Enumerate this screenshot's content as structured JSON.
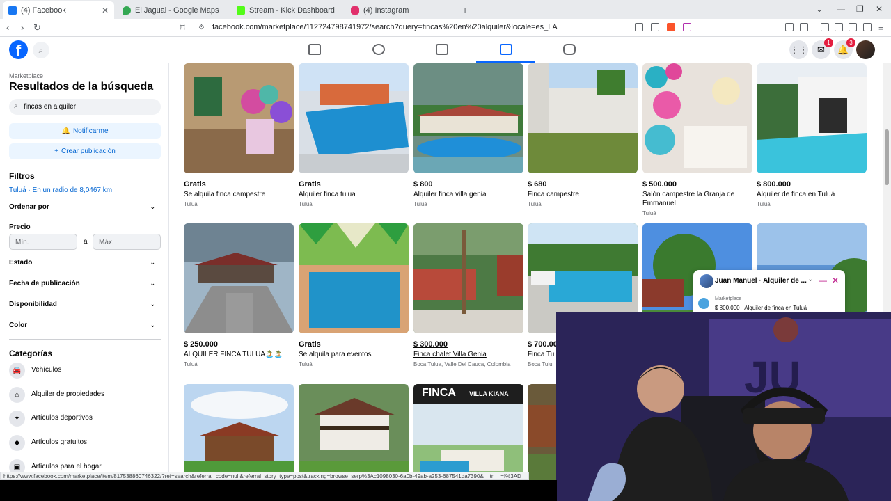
{
  "browser": {
    "tabs": [
      {
        "label": "(4) Facebook",
        "active": true,
        "color": "#1877f2"
      },
      {
        "label": "El Jagual - Google Maps",
        "active": false,
        "color": "#34a853"
      },
      {
        "label": "Stream - Kick Dashboard",
        "active": false,
        "color": "#53fc18"
      },
      {
        "label": "(4) Instagram",
        "active": false,
        "color": "#e1306c"
      }
    ],
    "new_tab": "+",
    "url": "facebook.com/marketplace/112724798741972/search?query=fincas%20en%20alquiler&locale=es_LA",
    "status_url": "https://www.facebook.com/marketplace/item/817538860746322/?ref=search&referral_code=null&referral_story_type=post&tracking=browse_serp%3Ac1098030-6a0b-49ab-a253-687541da7390&__tn__=!%3AD"
  },
  "header": {
    "logo": "f",
    "messenger_badge": "1",
    "notifications_badge": "3"
  },
  "sidebar": {
    "breadcrumb": "Marketplace",
    "title": "Resultados de la búsqueda",
    "search_value": "fincas en alquiler",
    "notify_label": "Notificarme",
    "create_label": "Crear publicación",
    "filters_heading": "Filtros",
    "location": "Tuluá · En un radio de 8,0467 km",
    "sort_label": "Ordenar por",
    "price_label": "Precio",
    "price_min_placeholder": "Mín.",
    "price_to": "a",
    "price_max_placeholder": "Máx.",
    "state_label": "Estado",
    "date_label": "Fecha de publicación",
    "availability_label": "Disponibilidad",
    "color_label": "Color",
    "categories_heading": "Categorías",
    "categories": [
      {
        "label": "Vehículos",
        "icon": "car-icon"
      },
      {
        "label": "Alquiler de propiedades",
        "icon": "house-icon"
      },
      {
        "label": "Artículos deportivos",
        "icon": "sports-icon"
      },
      {
        "label": "Artículos gratuitos",
        "icon": "tag-icon"
      },
      {
        "label": "Artículos para el hogar",
        "icon": "home-goods-icon"
      }
    ]
  },
  "listings": [
    {
      "price": "Gratis",
      "title": "Se alquila finca campestre",
      "location": "Tuluá",
      "img": "party"
    },
    {
      "price": "Gratis",
      "title": "Alquiler finca tulua",
      "location": "Tuluá",
      "img": "pool1"
    },
    {
      "price": "$ 800",
      "title": "Alquiler finca villa genia",
      "location": "Tuluá",
      "img": "villa"
    },
    {
      "price": "$ 680",
      "title": "Finca campestre",
      "location": "Tuluá",
      "img": "wall"
    },
    {
      "price": "$ 500.000",
      "title": "Salón campestre la Granja de Emmanuel",
      "location": "Tuluá",
      "img": "balloons"
    },
    {
      "price": "$ 800.000",
      "title": "Alquiler de finca en Tuluá",
      "location": "Tuluá",
      "img": "modern"
    },
    {
      "price": "$ 250.000",
      "title": "ALQUILER FINCA TULUA🏝️🏝️",
      "location": "Tuluá",
      "img": "kiosk"
    },
    {
      "price": "Gratis",
      "title": "Se alquila para eventos",
      "location": "Tuluá",
      "img": "pool2"
    },
    {
      "price": "$ 300.000",
      "title": "Finca chalet Villa Genia",
      "location": "Boca Tulua, Valle Del Cauca, Colombia",
      "img": "palms"
    },
    {
      "price": "$ 700.000",
      "title": "Finca Tulu",
      "location": "Boca Tulu",
      "img": "hedge"
    },
    {
      "price": "",
      "title": "",
      "location": "",
      "img": "trees"
    },
    {
      "price": "",
      "title": "",
      "location": "",
      "img": "sky"
    },
    {
      "price": "",
      "title": "",
      "location": "",
      "img": "cabin"
    },
    {
      "price": "",
      "title": "",
      "location": "",
      "img": "chalet"
    },
    {
      "price": "",
      "title": "",
      "location": "",
      "img": "finca_kiana"
    },
    {
      "price": "",
      "title": "",
      "location": "",
      "img": "wood"
    }
  ],
  "finca_kiana": {
    "big": "FINCA",
    "small": "VILLA KIANA"
  },
  "chat": {
    "name": "Juan Manuel · Alquiler de ...",
    "sub": "Marketplace",
    "message": "$ 800.000 · Alquiler de finca en Tuluá"
  },
  "colors": {
    "brand": "#0866ff",
    "link": "#0064d1",
    "button_bg": "#ebf5ff"
  }
}
